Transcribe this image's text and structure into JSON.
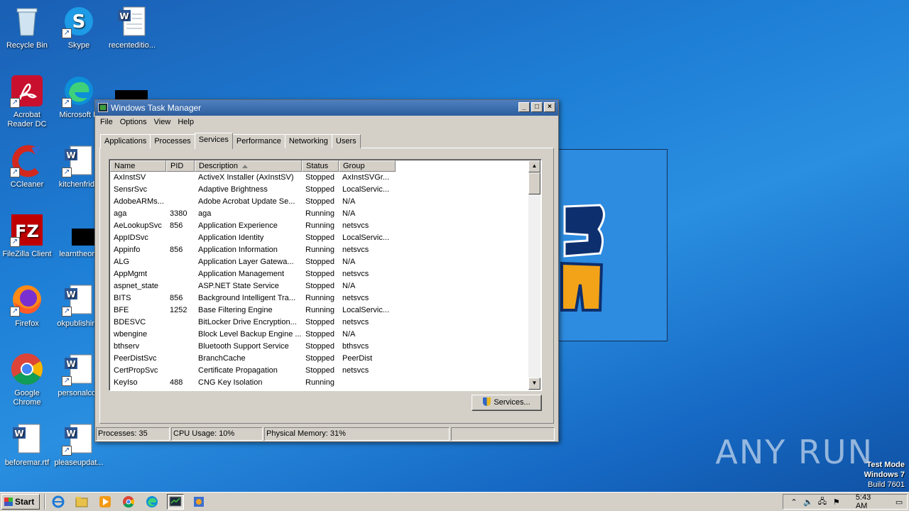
{
  "desktop": {
    "icons": [
      {
        "label": "Recycle Bin",
        "icon": "recycle-bin-icon"
      },
      {
        "label": "Skype",
        "icon": "skype-icon"
      },
      {
        "label": "recenteditio...",
        "icon": "word-document-icon"
      },
      {
        "label": "Acrobat Reader DC",
        "icon": "acrobat-icon"
      },
      {
        "label": "Microsoft E",
        "icon": "edge-icon"
      },
      {
        "label": "CCleaner",
        "icon": "ccleaner-icon"
      },
      {
        "label": "kitchenfrida",
        "icon": "word-document-icon"
      },
      {
        "label": "FileZilla Client",
        "icon": "filezilla-icon"
      },
      {
        "label": "learntheory",
        "icon": "blank-document-icon"
      },
      {
        "label": "Firefox",
        "icon": "firefox-icon"
      },
      {
        "label": "okpublishing",
        "icon": "word-document-icon"
      },
      {
        "label": "Google Chrome",
        "icon": "chrome-icon"
      },
      {
        "label": "personalcos",
        "icon": "word-document-icon"
      },
      {
        "label": "beforemar.rtf",
        "icon": "word-document-icon"
      },
      {
        "label": "pleaseupdat...",
        "icon": "word-document-icon"
      }
    ],
    "watermark": "ANY RUN",
    "test_mode": {
      "line1": "Test Mode",
      "line2": "Windows 7",
      "line3": "Build 7601"
    }
  },
  "task_manager": {
    "title": "Windows Task Manager",
    "menu": [
      "File",
      "Options",
      "View",
      "Help"
    ],
    "tabs": [
      "Applications",
      "Processes",
      "Services",
      "Performance",
      "Networking",
      "Users"
    ],
    "active_tab": "Services",
    "columns": [
      "Name",
      "PID",
      "Description",
      "Status",
      "Group"
    ],
    "sorted_column": "Description",
    "rows": [
      [
        "AxInstSV",
        "",
        "ActiveX Installer (AxInstSV)",
        "Stopped",
        "AxInstSVGr..."
      ],
      [
        "SensrSvc",
        "",
        "Adaptive Brightness",
        "Stopped",
        "LocalServic..."
      ],
      [
        "AdobeARMs...",
        "",
        "Adobe Acrobat Update Se...",
        "Stopped",
        "N/A"
      ],
      [
        "aga",
        "3380",
        "aga",
        "Running",
        "N/A"
      ],
      [
        "AeLookupSvc",
        "856",
        "Application Experience",
        "Running",
        "netsvcs"
      ],
      [
        "AppIDSvc",
        "",
        "Application Identity",
        "Stopped",
        "LocalServic..."
      ],
      [
        "Appinfo",
        "856",
        "Application Information",
        "Running",
        "netsvcs"
      ],
      [
        "ALG",
        "",
        "Application Layer Gatewa...",
        "Stopped",
        "N/A"
      ],
      [
        "AppMgmt",
        "",
        "Application Management",
        "Stopped",
        "netsvcs"
      ],
      [
        "aspnet_state",
        "",
        "ASP.NET State Service",
        "Stopped",
        "N/A"
      ],
      [
        "BITS",
        "856",
        "Background Intelligent Tra...",
        "Running",
        "netsvcs"
      ],
      [
        "BFE",
        "1252",
        "Base Filtering Engine",
        "Running",
        "LocalServic..."
      ],
      [
        "BDESVC",
        "",
        "BitLocker Drive Encryption...",
        "Stopped",
        "netsvcs"
      ],
      [
        "wbengine",
        "",
        "Block Level Backup Engine ...",
        "Stopped",
        "N/A"
      ],
      [
        "bthserv",
        "",
        "Bluetooth Support Service",
        "Stopped",
        "bthsvcs"
      ],
      [
        "PeerDistSvc",
        "",
        "BranchCache",
        "Stopped",
        "PeerDist"
      ],
      [
        "CertPropSvc",
        "",
        "Certificate Propagation",
        "Stopped",
        "netsvcs"
      ],
      [
        "KeyIso",
        "488",
        "CNG Key Isolation",
        "Running",
        ""
      ]
    ],
    "services_button": "Services...",
    "status": {
      "processes": "Processes: 35",
      "cpu": "CPU Usage: 10%",
      "memory": "Physical Memory: 31%"
    }
  },
  "taskbar": {
    "start_label": "Start",
    "clock": "5:43 AM",
    "apps": [
      "ie-icon",
      "explorer-icon",
      "media-player-icon",
      "chrome-icon",
      "edge-icon",
      "task-manager-icon",
      "paint-icon"
    ]
  }
}
